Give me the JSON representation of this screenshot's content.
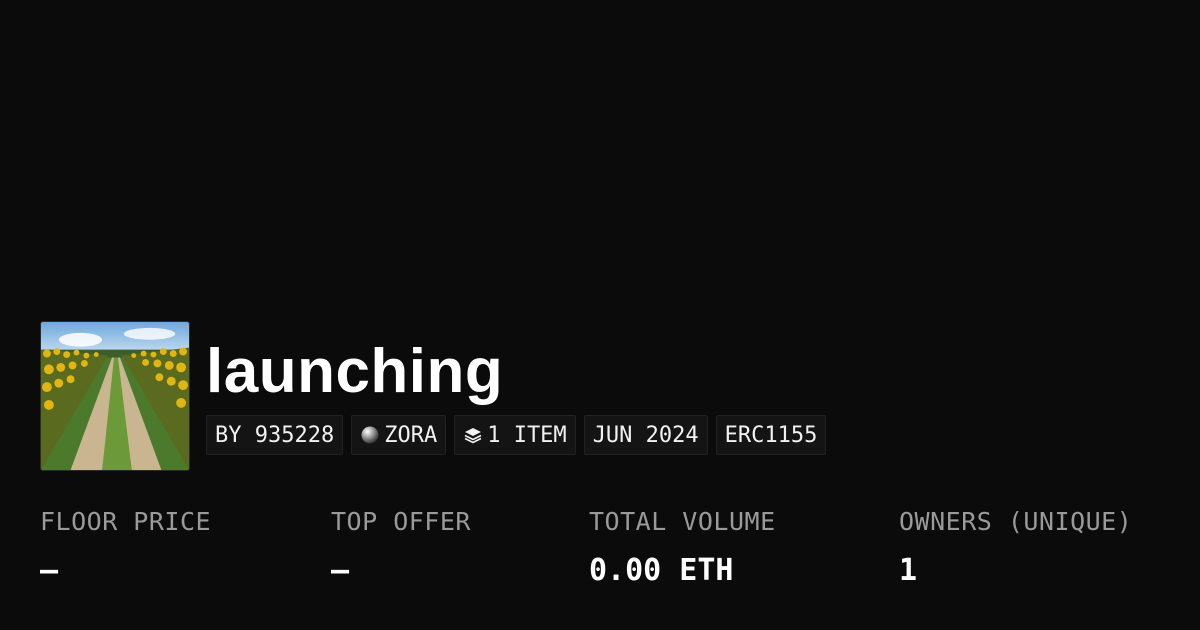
{
  "collection": {
    "name": "launching",
    "thumbnail_icon": "sunflower-field-road-image"
  },
  "tags": {
    "creator": "BY 935228",
    "chain": "ZORA",
    "chain_icon": "zora-orb-icon",
    "items": "1 ITEM",
    "items_icon": "layers-icon",
    "date": "JUN 2024",
    "standard": "ERC1155"
  },
  "stats": {
    "floor_price": {
      "label": "FLOOR PRICE",
      "value": "–"
    },
    "top_offer": {
      "label": "TOP OFFER",
      "value": "–"
    },
    "total_volume": {
      "label": "TOTAL VOLUME",
      "value": "0.00 ETH"
    },
    "owners": {
      "label": "OWNERS (UNIQUE)",
      "value": "1"
    }
  }
}
